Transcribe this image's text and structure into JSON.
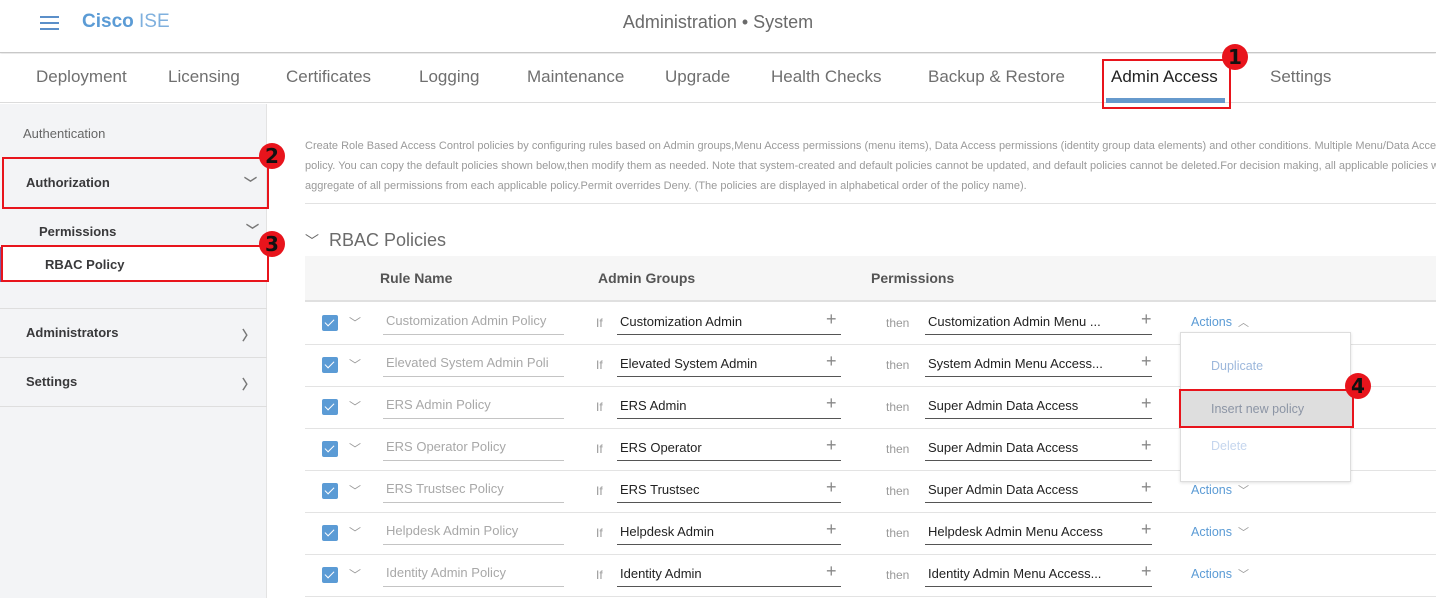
{
  "header": {
    "brand_bold": "Cisco",
    "brand_light": "ISE",
    "title": "Administration • System"
  },
  "tabs": [
    {
      "label": "Deployment"
    },
    {
      "label": "Licensing"
    },
    {
      "label": "Certificates"
    },
    {
      "label": "Logging"
    },
    {
      "label": "Maintenance"
    },
    {
      "label": "Upgrade"
    },
    {
      "label": "Health Checks"
    },
    {
      "label": "Backup & Restore"
    },
    {
      "label": "Admin Access",
      "active": true
    },
    {
      "label": "Settings"
    }
  ],
  "sidebar": {
    "authentication": "Authentication",
    "authorization": "Authorization",
    "permissions": "Permissions",
    "rbac_policy": "RBAC Policy",
    "administrators": "Administrators",
    "settings": "Settings"
  },
  "description": {
    "line1": "Create Role Based Access Control policies by configuring rules based on Admin groups,Menu Access permissions (menu items), Data Access permissions (identity group data elements) and other conditions. Multiple Menu/Data Access permissions are not allowed on a single",
    "line2": "policy. You can copy the default policies shown below,then modify them as needed. Note that system-created and default policies cannot be updated, and default policies cannot be deleted.For decision making, all applicable policies will be evaluated. The subject's permissions will be the",
    "line3": "aggregate of all permissions from each applicable policy.Permit overrides Deny. (The policies are displayed in alphabetical order of the policy name)."
  },
  "section": {
    "title": "RBAC Policies"
  },
  "table": {
    "columns": {
      "rule_name": "Rule Name",
      "admin_groups": "Admin Groups",
      "permissions": "Permissions"
    },
    "if_label": "If",
    "then_label": "then",
    "actions_label": "Actions",
    "rows": [
      {
        "checked": true,
        "rule_name": "Customization Admin Policy",
        "admin_group": "Customization Admin",
        "permission": "Customization Admin Menu ...",
        "actions_open": true
      },
      {
        "checked": true,
        "rule_name": "Elevated System Admin Poli",
        "admin_group": "Elevated System Admin",
        "permission": "System Admin Menu Access..."
      },
      {
        "checked": true,
        "rule_name": "ERS Admin Policy",
        "admin_group": "ERS Admin",
        "permission": "Super Admin Data Access"
      },
      {
        "checked": true,
        "rule_name": "ERS Operator Policy",
        "admin_group": "ERS Operator",
        "permission": "Super Admin Data Access"
      },
      {
        "checked": true,
        "rule_name": "ERS Trustsec Policy",
        "admin_group": "ERS Trustsec",
        "permission": "Super Admin Data Access"
      },
      {
        "checked": true,
        "rule_name": "Helpdesk Admin Policy",
        "admin_group": "Helpdesk Admin",
        "permission": "Helpdesk Admin Menu Access"
      },
      {
        "checked": true,
        "rule_name": "Identity Admin Policy",
        "admin_group": "Identity Admin",
        "permission": "Identity Admin Menu Access..."
      }
    ]
  },
  "actions_menu": {
    "items": [
      {
        "label": "Duplicate"
      },
      {
        "label": "Insert new policy",
        "highlighted": true
      },
      {
        "label": "Delete",
        "disabled": true
      }
    ]
  },
  "callouts": [
    "1",
    "2",
    "3",
    "4"
  ],
  "colors": {
    "accent": "#5b9bd5",
    "callout": "#e8141c",
    "tab_underline": "#6699cc"
  }
}
